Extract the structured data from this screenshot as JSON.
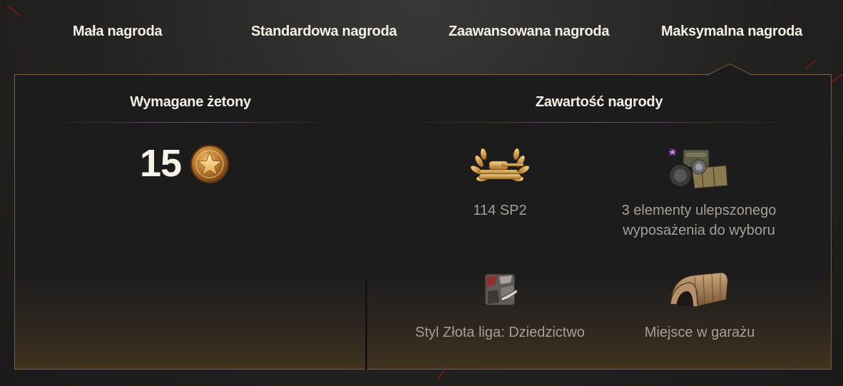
{
  "tabs": [
    {
      "label": "Mała nagroda"
    },
    {
      "label": "Standardowa nagroda"
    },
    {
      "label": "Zaawansowana nagroda"
    },
    {
      "label": "Maksymalna nagroda"
    }
  ],
  "active_tab": "Maksymalna nagroda",
  "left": {
    "title": "Wymagane żetony",
    "token_count": "15",
    "token_icon": "gold-star-coin-icon"
  },
  "right": {
    "title": "Zawartość nagrody",
    "rewards": [
      {
        "label": "114 SP2",
        "icon": "laurel-tank-icon"
      },
      {
        "label_line1": "3 elementy ulepszonego",
        "label_line2": "wyposażenia do wyboru",
        "icon": "equipment-crate-icon"
      },
      {
        "label": "Styl Złota liga: Dziedzictwo",
        "icon": "style-camo-icon"
      },
      {
        "label": "Miejsce w garażu",
        "icon": "garage-slot-icon"
      }
    ]
  },
  "colors": {
    "panel_border": "#7b5f3c",
    "accent_gold": "#c99a3e",
    "label_grey": "#a59f95"
  }
}
